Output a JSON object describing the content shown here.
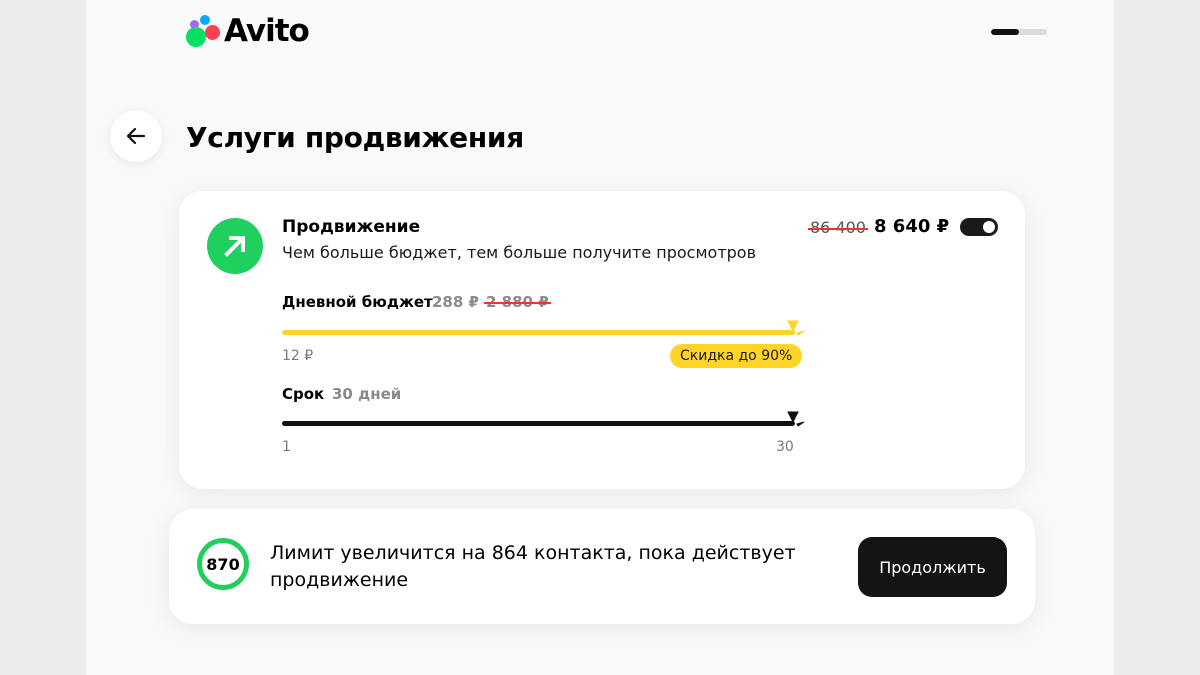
{
  "header": {
    "logo_text": "Avito",
    "logo_colors": [
      "#00aaff",
      "#a169f7",
      "#04e061",
      "#ff4053"
    ],
    "step_progress": 0.5
  },
  "page": {
    "back_icon": "arrow-left-icon",
    "title": "Услуги продвижения"
  },
  "promotion": {
    "icon": "arrow-up-right-icon",
    "icon_color": "#1fd05f",
    "title": "Продвижение",
    "description": "Чем больше бюджет, тем больше получите просмотров",
    "old_price": "86 400",
    "new_price": "8 640 ₽",
    "enabled": true,
    "budget": {
      "label": "Дневной бюджет",
      "value": "288 ₽",
      "old_value": "2 880 ₽",
      "min_label": "12 ₽",
      "discount_badge": "Скидка до 90%",
      "level": 1.0,
      "color": "#ffd429"
    },
    "term": {
      "label": "Срок",
      "value": "30 дней",
      "min_label": "1",
      "max_label": "30",
      "level": 1.0,
      "color": "#111111"
    }
  },
  "limit": {
    "count": "870",
    "ring_color": "#1fd05f",
    "text": "Лимит увеличится на 864 контакта, пока действует продвижение",
    "cta_label": "Продолжить"
  }
}
